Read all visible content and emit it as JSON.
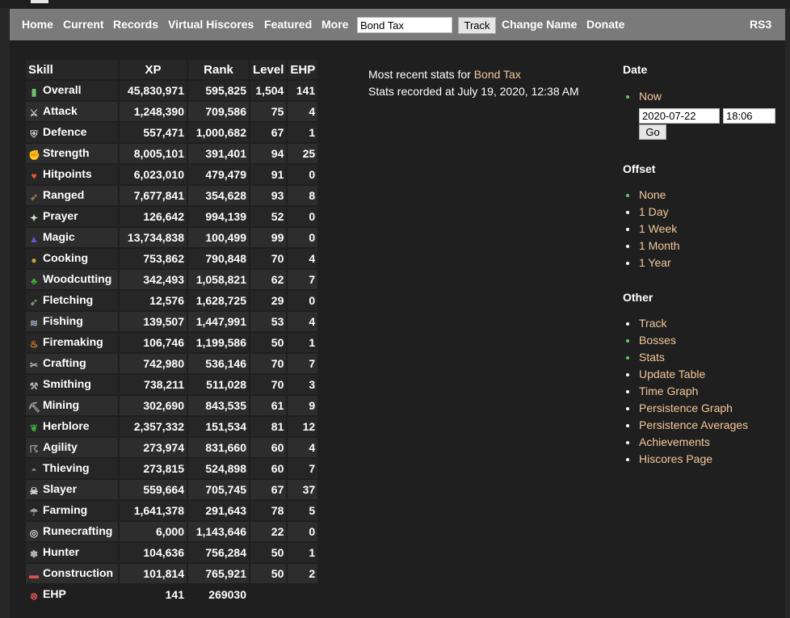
{
  "nav": {
    "links": [
      "Home",
      "Current",
      "Records",
      "Virtual Hiscores",
      "Featured",
      "More"
    ],
    "search_value": "Bond Tax",
    "track_button": "Track",
    "change_name": "Change Name",
    "donate": "Donate",
    "rs3": "RS3"
  },
  "table": {
    "headers": [
      "Skill",
      "XP",
      "Rank",
      "Level",
      "EHP"
    ],
    "rows": [
      {
        "skill": "Overall",
        "icon": "overall-icon",
        "xp": "45,830,971",
        "rank": "595,825",
        "level": "1,504",
        "ehp": "141"
      },
      {
        "skill": "Attack",
        "icon": "attack-icon",
        "xp": "1,248,390",
        "rank": "709,586",
        "level": "75",
        "ehp": "4"
      },
      {
        "skill": "Defence",
        "icon": "defence-icon",
        "xp": "557,471",
        "rank": "1,000,682",
        "level": "67",
        "ehp": "1"
      },
      {
        "skill": "Strength",
        "icon": "strength-icon",
        "xp": "8,005,101",
        "rank": "391,401",
        "level": "94",
        "ehp": "25"
      },
      {
        "skill": "Hitpoints",
        "icon": "hitpoints-icon",
        "xp": "6,023,010",
        "rank": "479,479",
        "level": "91",
        "ehp": "0"
      },
      {
        "skill": "Ranged",
        "icon": "ranged-icon",
        "xp": "7,677,841",
        "rank": "354,628",
        "level": "93",
        "ehp": "8"
      },
      {
        "skill": "Prayer",
        "icon": "prayer-icon",
        "xp": "126,642",
        "rank": "994,139",
        "level": "52",
        "ehp": "0"
      },
      {
        "skill": "Magic",
        "icon": "magic-icon",
        "xp": "13,734,838",
        "rank": "100,499",
        "level": "99",
        "ehp": "0"
      },
      {
        "skill": "Cooking",
        "icon": "cooking-icon",
        "xp": "753,862",
        "rank": "790,848",
        "level": "70",
        "ehp": "4"
      },
      {
        "skill": "Woodcutting",
        "icon": "woodcutting-icon",
        "xp": "342,493",
        "rank": "1,058,821",
        "level": "62",
        "ehp": "7"
      },
      {
        "skill": "Fletching",
        "icon": "fletching-icon",
        "xp": "12,576",
        "rank": "1,628,725",
        "level": "29",
        "ehp": "0"
      },
      {
        "skill": "Fishing",
        "icon": "fishing-icon",
        "xp": "139,507",
        "rank": "1,447,991",
        "level": "53",
        "ehp": "4"
      },
      {
        "skill": "Firemaking",
        "icon": "firemaking-icon",
        "xp": "106,746",
        "rank": "1,199,586",
        "level": "50",
        "ehp": "1"
      },
      {
        "skill": "Crafting",
        "icon": "crafting-icon",
        "xp": "742,980",
        "rank": "536,146",
        "level": "70",
        "ehp": "7"
      },
      {
        "skill": "Smithing",
        "icon": "smithing-icon",
        "xp": "738,211",
        "rank": "511,028",
        "level": "70",
        "ehp": "3"
      },
      {
        "skill": "Mining",
        "icon": "mining-icon",
        "xp": "302,690",
        "rank": "843,535",
        "level": "61",
        "ehp": "9"
      },
      {
        "skill": "Herblore",
        "icon": "herblore-icon",
        "xp": "2,357,332",
        "rank": "151,534",
        "level": "81",
        "ehp": "12"
      },
      {
        "skill": "Agility",
        "icon": "agility-icon",
        "xp": "273,974",
        "rank": "831,660",
        "level": "60",
        "ehp": "4"
      },
      {
        "skill": "Thieving",
        "icon": "thieving-icon",
        "xp": "273,815",
        "rank": "524,898",
        "level": "60",
        "ehp": "7"
      },
      {
        "skill": "Slayer",
        "icon": "slayer-icon",
        "xp": "559,664",
        "rank": "705,745",
        "level": "67",
        "ehp": "37"
      },
      {
        "skill": "Farming",
        "icon": "farming-icon",
        "xp": "1,641,378",
        "rank": "291,643",
        "level": "78",
        "ehp": "5"
      },
      {
        "skill": "Runecrafting",
        "icon": "runecrafting-icon",
        "xp": "6,000",
        "rank": "1,143,646",
        "level": "22",
        "ehp": "0"
      },
      {
        "skill": "Hunter",
        "icon": "hunter-icon",
        "xp": "104,636",
        "rank": "756,284",
        "level": "50",
        "ehp": "1"
      },
      {
        "skill": "Construction",
        "icon": "construction-icon",
        "xp": "101,814",
        "rank": "765,921",
        "level": "50",
        "ehp": "2"
      }
    ],
    "ehp_row": {
      "skill": "EHP",
      "icon": "ehp-icon",
      "xp": "141",
      "rank": "269030"
    }
  },
  "recent": {
    "prefix": "Most recent stats for ",
    "player": "Bond Tax",
    "recorded": "Stats recorded at July 19, 2020, 12:38 AM"
  },
  "date": {
    "heading": "Date",
    "now": "Now",
    "date_value": "2020-07-22",
    "time_value": "18:06",
    "go": "Go"
  },
  "offset": {
    "heading": "Offset",
    "items": [
      "None",
      "1 Day",
      "1 Week",
      "1 Month",
      "1 Year"
    ]
  },
  "other": {
    "heading": "Other",
    "items": [
      "Track",
      "Bosses",
      "Stats",
      "Update Table",
      "Time Graph",
      "Persistence Graph",
      "Persistence Averages",
      "Achievements",
      "Hiscores Page"
    ]
  },
  "colors": {
    "accent": "#f4c89a",
    "active_bullet": "#5fcf5f",
    "navbar": "#7a7a7a",
    "panel": "#1f1f1f"
  }
}
